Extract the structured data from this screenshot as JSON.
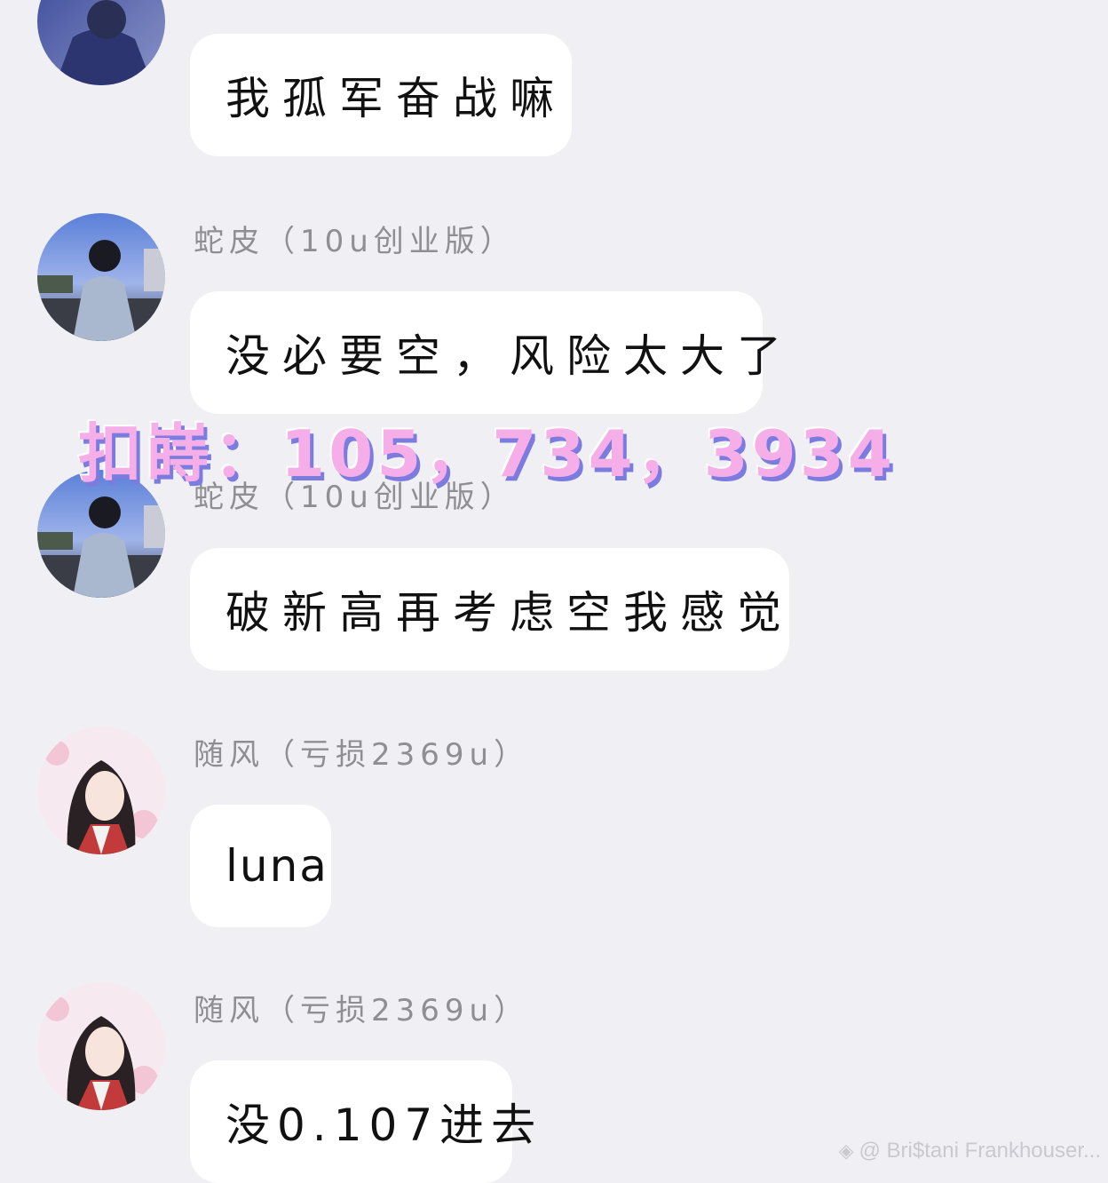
{
  "messages": [
    {
      "sender": "",
      "text": "我孤军奋战嘛",
      "avatar": "man-blue-avatar"
    },
    {
      "sender": "蛇皮（10u创业版）",
      "text": "没必要空，风险太大了",
      "avatar": "man-jacket-avatar"
    },
    {
      "sender": "蛇皮（10u创业版）",
      "text": "破新高再考虑空我感觉",
      "avatar": "man-jacket-avatar"
    },
    {
      "sender": "随风（亏损2369u）",
      "text": "luna",
      "avatar": "anime-girl-avatar"
    },
    {
      "sender": "随风（亏损2369u）",
      "text": "没0.107进去",
      "avatar": "anime-girl-avatar"
    }
  ],
  "overlay": {
    "text": "扣嵵：105，734，3934",
    "color": "#f6aee8",
    "shadow_color": "#7b7be0"
  },
  "credit": {
    "icon": "weibo-diamond-icon",
    "text": "@ Bri$tani Frankhouser..."
  },
  "colors": {
    "background": "#f0eff4",
    "bubble": "#ffffff",
    "sender_text": "#8e8e93",
    "message_text": "#111111"
  }
}
